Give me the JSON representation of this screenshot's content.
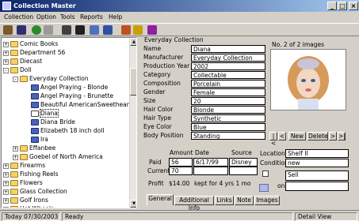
{
  "window": {
    "title": "Collection Master"
  },
  "menu": [
    "Collection",
    "Option",
    "Tools",
    "Reports",
    "Help"
  ],
  "tree": {
    "items": [
      {
        "label": "Comic Books",
        "indent": 0,
        "icon": "folder",
        "exp": "+"
      },
      {
        "label": "Department 56",
        "indent": 0,
        "icon": "folder",
        "exp": "+"
      },
      {
        "label": "Diecast",
        "indent": 0,
        "icon": "folder",
        "exp": "+"
      },
      {
        "label": "Doll",
        "indent": 0,
        "icon": "folder",
        "exp": "-"
      },
      {
        "label": "Everyday Collection",
        "indent": 1,
        "icon": "folder",
        "exp": "-"
      },
      {
        "label": "Angel Praying - Blonde",
        "indent": 2,
        "icon": "doll",
        "exp": ""
      },
      {
        "label": "Angel Praying - Brunette",
        "indent": 2,
        "icon": "doll",
        "exp": ""
      },
      {
        "label": "Beautiful AmericanSweetheart",
        "indent": 2,
        "icon": "doll",
        "exp": ""
      },
      {
        "label": "Diana",
        "indent": 2,
        "icon": "selected",
        "exp": "",
        "selected": true
      },
      {
        "label": "Diana Bride",
        "indent": 2,
        "icon": "doll",
        "exp": ""
      },
      {
        "label": "Elizabeth 18 inch doll",
        "indent": 2,
        "icon": "doll",
        "exp": ""
      },
      {
        "label": "Ira",
        "indent": 2,
        "icon": "doll",
        "exp": ""
      },
      {
        "label": "Effanbee",
        "indent": 1,
        "icon": "folder",
        "exp": "+"
      },
      {
        "label": "Goebel of North America",
        "indent": 1,
        "icon": "folder",
        "exp": "+"
      },
      {
        "label": "Firearms",
        "indent": 0,
        "icon": "folder",
        "exp": "+"
      },
      {
        "label": "Fishing Reels",
        "indent": 0,
        "icon": "folder",
        "exp": "+"
      },
      {
        "label": "Flowers",
        "indent": 0,
        "icon": "folder",
        "exp": "+"
      },
      {
        "label": "Glass Collection",
        "indent": 0,
        "icon": "folder",
        "exp": "+"
      },
      {
        "label": "Golf Irons",
        "indent": 0,
        "icon": "folder",
        "exp": "+"
      },
      {
        "label": "Hot Wheels",
        "indent": 0,
        "icon": "folder",
        "exp": "+"
      }
    ]
  },
  "detail": {
    "section_title": "Everyday Collection",
    "fields": [
      {
        "label": "Name",
        "value": "Diana"
      },
      {
        "label": "Manufacturer",
        "value": "Everyday Collection"
      },
      {
        "label": "Production Year",
        "value": "2002"
      },
      {
        "label": "Category",
        "value": "Collectable"
      },
      {
        "label": "Composition",
        "value": "Porcelain"
      },
      {
        "label": "Gender",
        "value": "Female"
      },
      {
        "label": "Size",
        "value": "20"
      },
      {
        "label": "Hair Color",
        "value": "Blonde"
      },
      {
        "label": "Hair Type",
        "value": "Synthetic"
      },
      {
        "label": "Eye Color",
        "value": "Blue"
      },
      {
        "label": "Body Position",
        "value": "Standing"
      }
    ]
  },
  "image": {
    "caption": "No. 2 of 2 images",
    "nav": {
      "first": "|<",
      "prev": "<",
      "new": "New",
      "delete": "Delete",
      "next": ">",
      "last": ">|"
    }
  },
  "purchase": {
    "headers": {
      "amount": "Amount",
      "date": "Date",
      "source": "Source"
    },
    "paid_label": "Paid",
    "current_label": "Current",
    "paid": {
      "amount": "56",
      "date": "6/17/99",
      "source": "Disney"
    },
    "current": {
      "amount": "70"
    },
    "profit_label": "Profit",
    "profit_value": "$14.00",
    "profit_note": "kept for 4 yrs 1 mo"
  },
  "location": {
    "location_label": "Location",
    "location_value": "Shelf II",
    "condition_label": "Condition",
    "condition_value": "new",
    "sell_value": "Sell",
    "on_label": "on"
  },
  "tabs": [
    "General",
    "Additional Info",
    "Links",
    "Note",
    "Images"
  ],
  "status": {
    "today": "Today 07/30/2003",
    "state": "Ready",
    "view": "Detail View"
  },
  "colors": {
    "title_gradient_start": "#0a246a",
    "title_gradient_end": "#a6caf0",
    "chrome": "#d4d0c8",
    "folder_icon": "#f5d16a",
    "doll_icon": "#4a62b8"
  }
}
